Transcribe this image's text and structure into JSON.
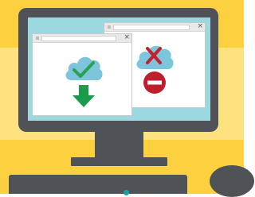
{
  "scene": {
    "colors": {
      "bg_top": "#fcd03e",
      "bg_mid": "#fde27f",
      "bg_bot": "#fcd03e",
      "device": "#4f5257",
      "screen": "#9bd8df",
      "cloud": "#7cc5dc",
      "check": "#2aa14f",
      "arrow": "#1a9d4b",
      "x_mark": "#c4202e",
      "stop": "#be1e2d"
    }
  },
  "windows": {
    "front": {
      "close_glyph": "×",
      "icons": [
        "cloud-check-icon",
        "download-arrow-icon"
      ]
    },
    "back": {
      "close_glyph": "×",
      "icons": [
        "cloud-x-icon",
        "stop-icon"
      ]
    }
  }
}
